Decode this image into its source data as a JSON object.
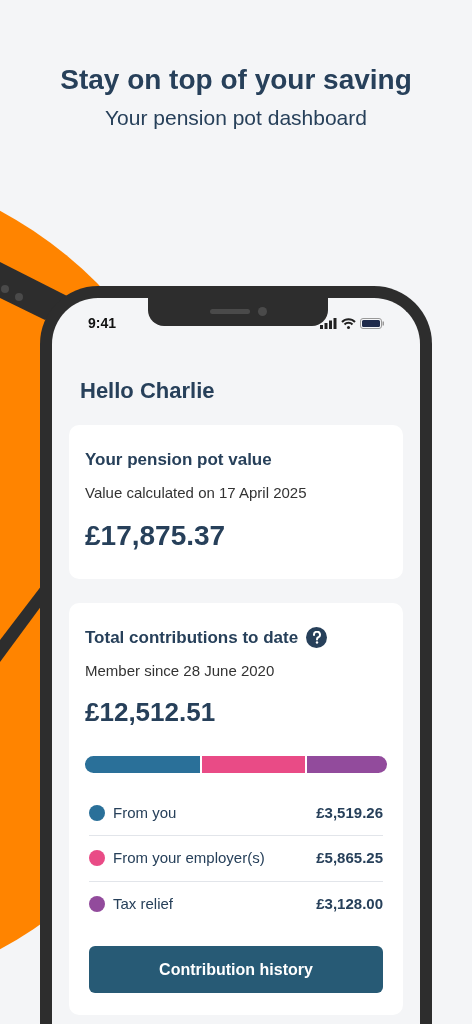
{
  "header": {
    "title": "Stay on top of your saving",
    "subtitle": "Your pension pot dashboard"
  },
  "status_bar": {
    "time": "9:41"
  },
  "greeting": "Hello Charlie",
  "pot_card": {
    "title": "Your pension pot value",
    "note": "Value calculated on 17 April 2025",
    "amount": "£17,875.37"
  },
  "contributions_card": {
    "title": "Total contributions to date",
    "note": "Member since 28 June 2020",
    "amount": "£12,512.51",
    "segments": [
      {
        "label": "From you",
        "amount": "£3,519.26",
        "color": "#2a7099"
      },
      {
        "label": "From your employer(s)",
        "amount": "£5,865.25",
        "color": "#e94b86"
      },
      {
        "label": "Tax relief",
        "amount": "£3,128.00",
        "color": "#924b9c"
      }
    ],
    "button": "Contribution history"
  }
}
